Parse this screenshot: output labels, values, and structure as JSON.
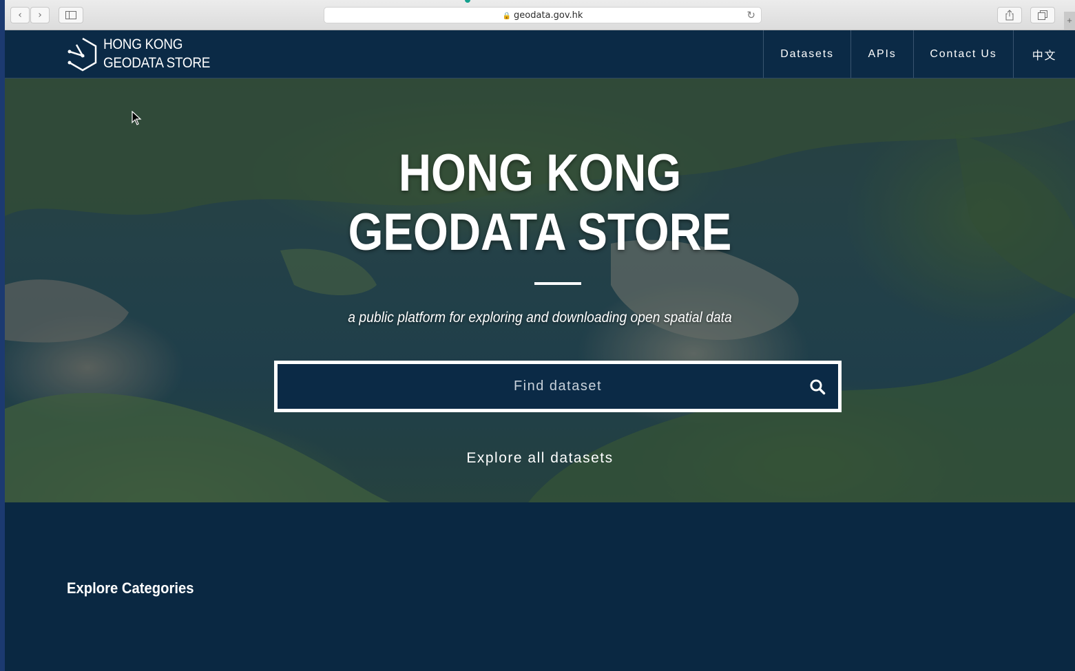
{
  "browser": {
    "url": "geodata.gov.hk",
    "back_icon": "chevron-left-icon",
    "forward_icon": "chevron-right-icon",
    "sidebar_icon": "sidebar-icon",
    "lock_icon": "lock-icon",
    "reload_icon": "reload-icon",
    "share_icon": "share-icon",
    "tabs_icon": "tabs-icon"
  },
  "header": {
    "logo_line1": "HONG KONG",
    "logo_line2": "GEODATA STORE",
    "nav": {
      "datasets": "Datasets",
      "apis": "APIs",
      "contact": "Contact Us",
      "language": "中文"
    }
  },
  "hero": {
    "title_line1": "HONG KONG",
    "title_line2": "GEODATA STORE",
    "subtitle": "a public platform for exploring and downloading open spatial data",
    "search_placeholder": "Find dataset",
    "explore_all": "Explore all datasets"
  },
  "categories": {
    "heading": "Explore Categories"
  },
  "colors": {
    "navy": "#0b2a46",
    "white": "#ffffff",
    "outer_frame": "#1c3a70"
  }
}
